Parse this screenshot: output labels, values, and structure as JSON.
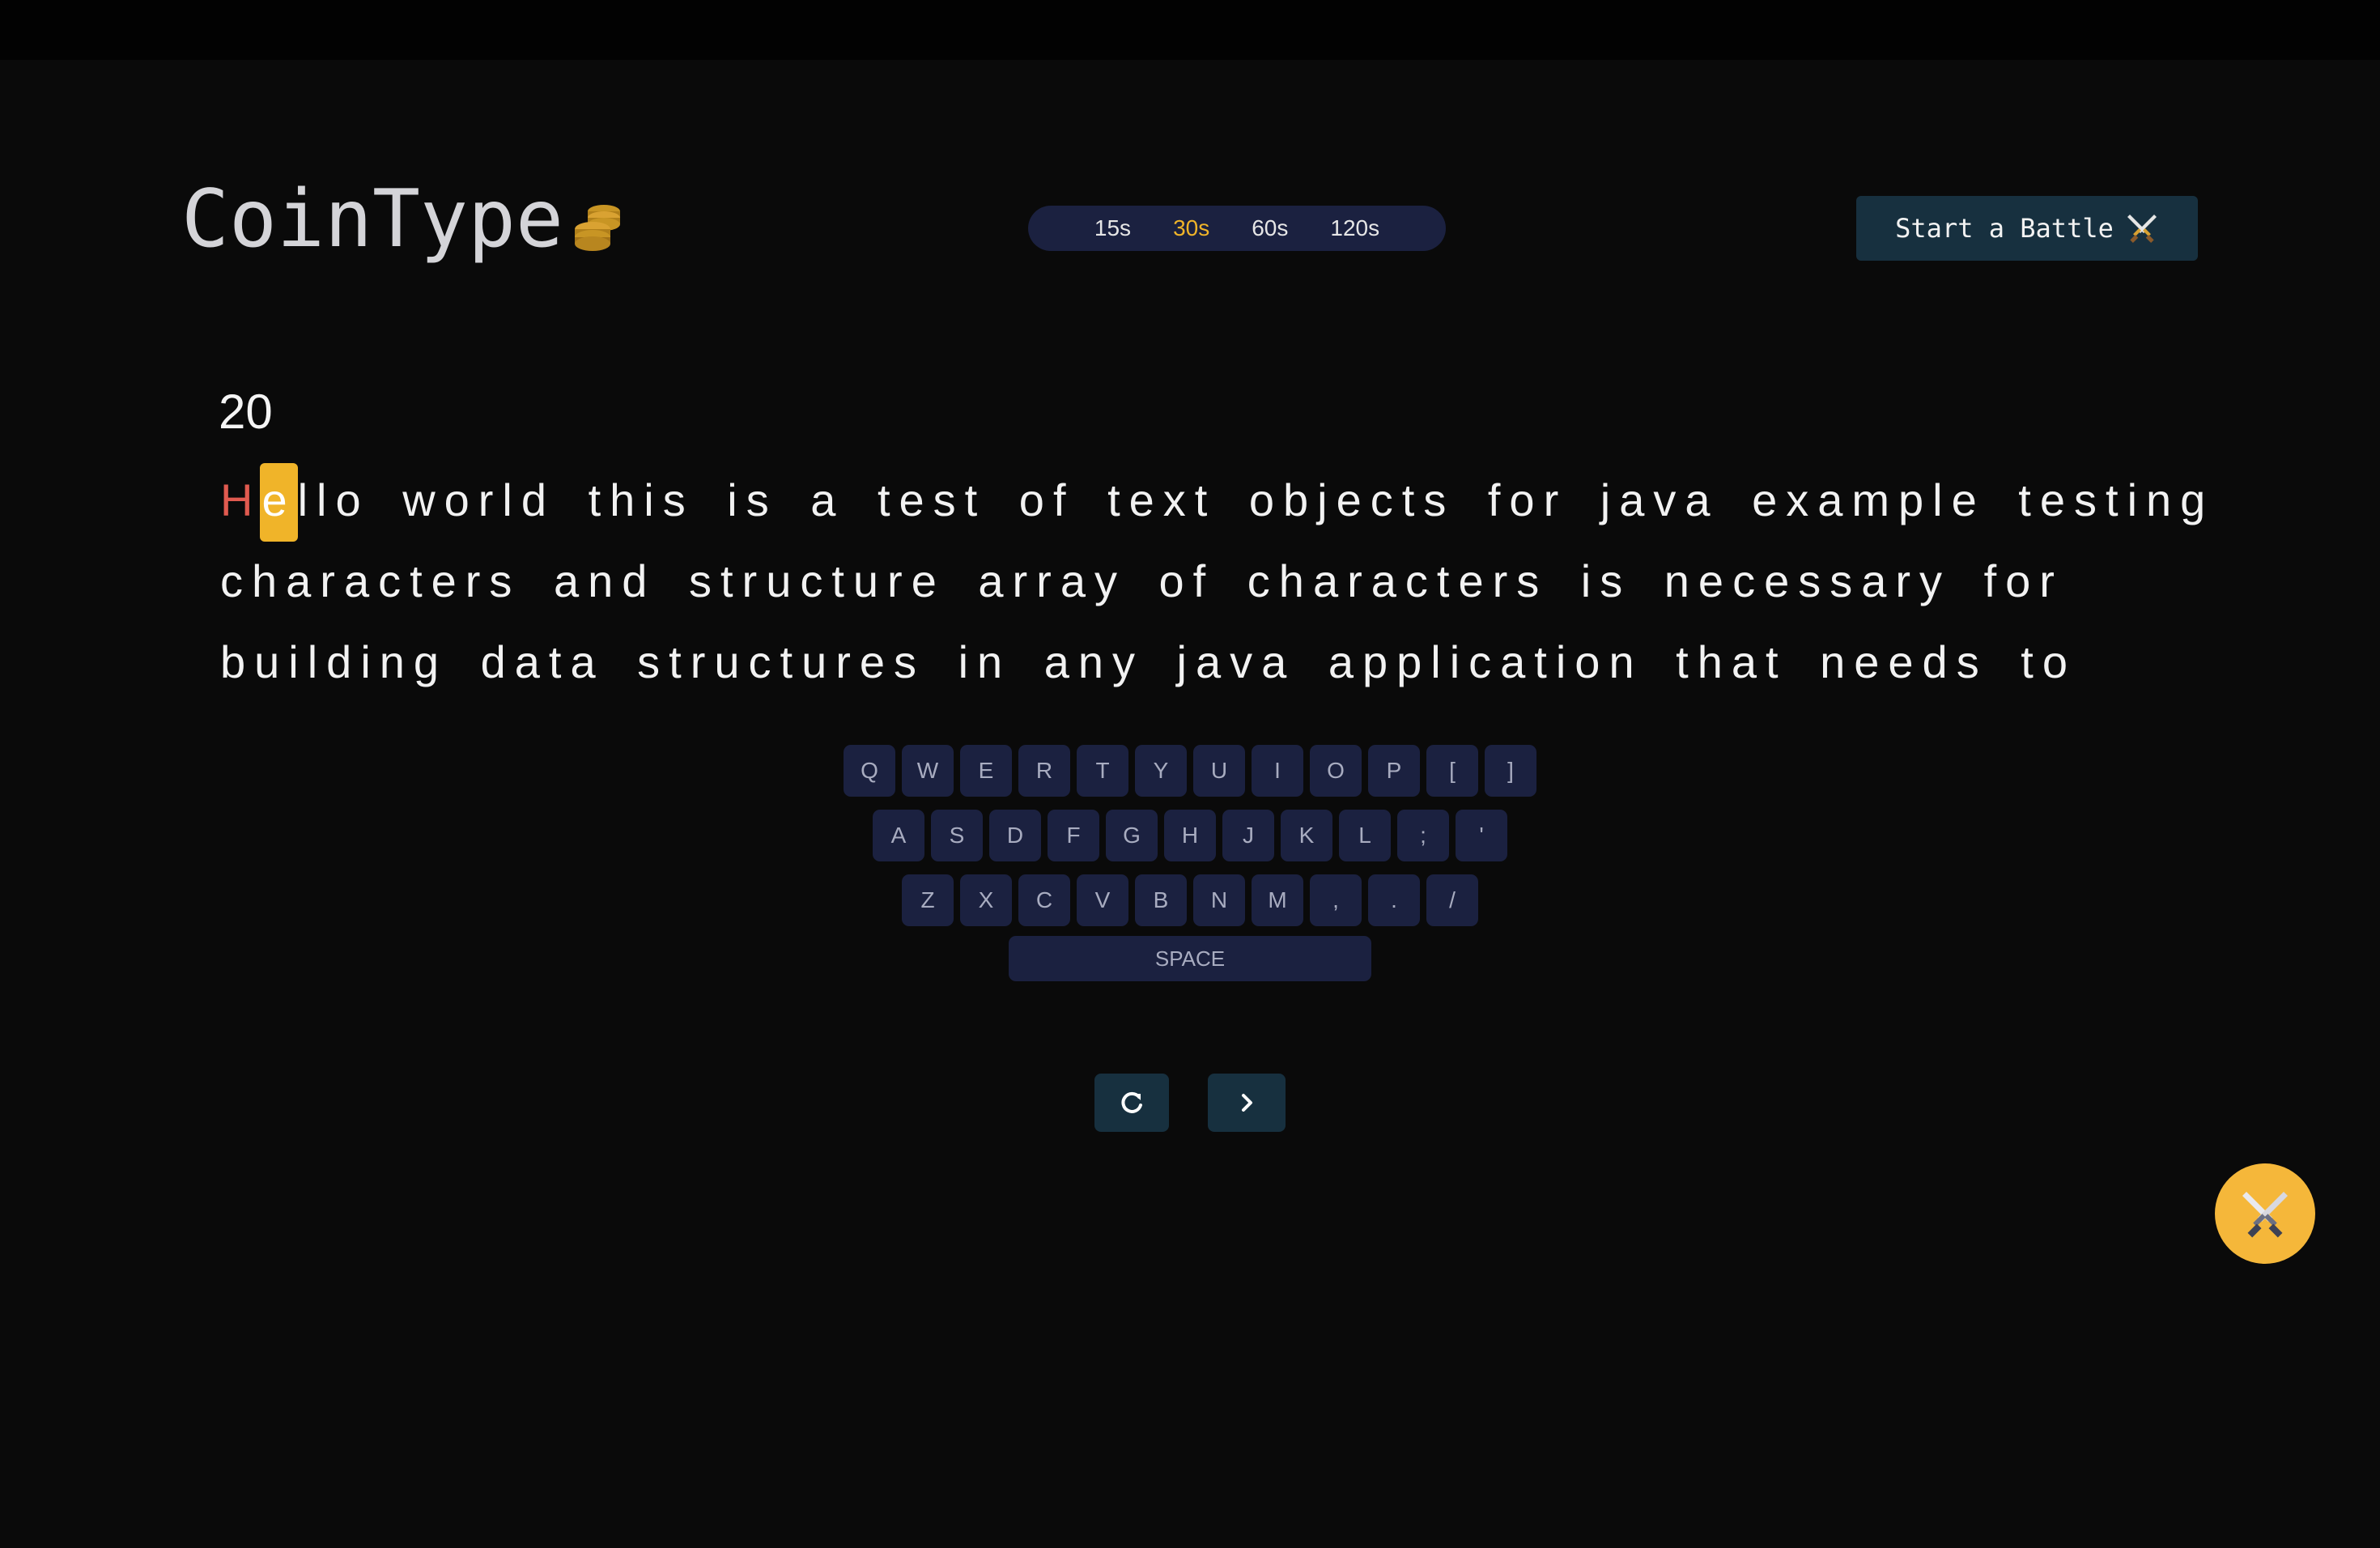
{
  "app": {
    "title": "CoinType",
    "logo_icon": "coins-icon"
  },
  "time_options": [
    {
      "label": "15s",
      "active": false
    },
    {
      "label": "30s",
      "active": true
    },
    {
      "label": "60s",
      "active": false
    },
    {
      "label": "120s",
      "active": false
    }
  ],
  "battle_button": {
    "label": "Start a Battle",
    "icon": "crossed-swords-icon"
  },
  "timer": {
    "value": "20"
  },
  "typing": {
    "typed": "H",
    "current": "e",
    "line1_rest": "llo world this is a test of text objects for java example testing",
    "line2": "characters and structure array of characters is necessary for",
    "line3": "building data structures in any java application that needs to"
  },
  "keyboard": {
    "row1": [
      "Q",
      "W",
      "E",
      "R",
      "T",
      "Y",
      "U",
      "I",
      "O",
      "P",
      "[",
      "]"
    ],
    "row2": [
      "A",
      "S",
      "D",
      "F",
      "G",
      "H",
      "J",
      "K",
      "L",
      ";",
      "'"
    ],
    "row3": [
      "Z",
      "X",
      "C",
      "V",
      "B",
      "N",
      "M",
      ",",
      ".",
      "/"
    ],
    "space": "SPACE"
  },
  "controls": {
    "restart_icon": "restart-icon",
    "next_icon": "chevron-right-icon"
  },
  "fab": {
    "icon": "crossed-swords-icon"
  },
  "colors": {
    "background": "#0a0a0a",
    "accent": "#f0b429",
    "error": "#e05a4f",
    "pill": "#1b2140",
    "button": "#17303f"
  }
}
